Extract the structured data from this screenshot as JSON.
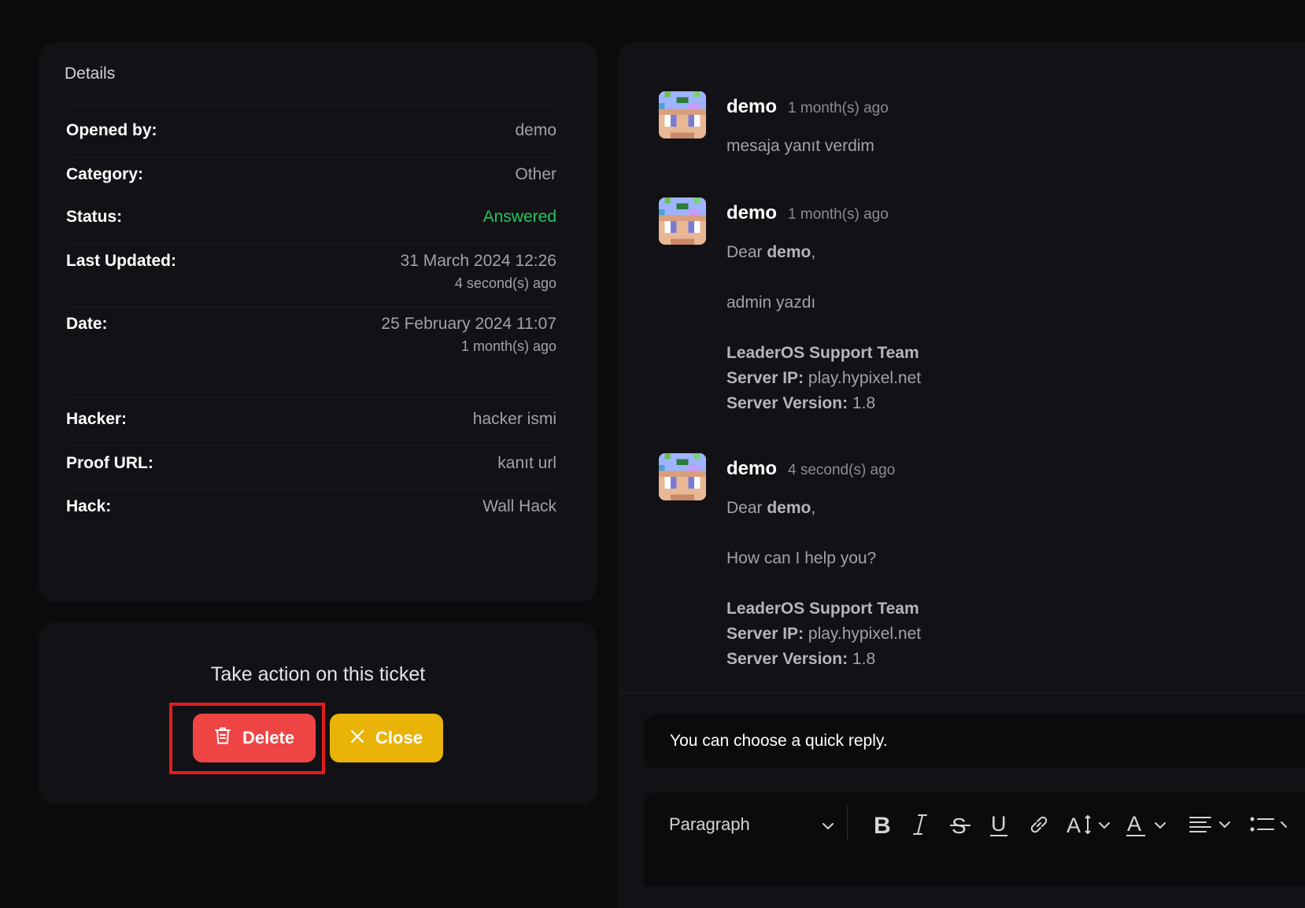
{
  "details": {
    "title": "Details",
    "rows": [
      {
        "label": "Opened by:",
        "value": "demo"
      },
      {
        "label": "Category:",
        "value": "Other"
      },
      {
        "label": "Status:",
        "value": "Answered"
      },
      {
        "label": "Last Updated:",
        "value": "31 March 2024 12:26",
        "sub": "4 second(s) ago"
      },
      {
        "label": "Date:",
        "value": "25 February 2024 11:07",
        "sub": "1 month(s) ago"
      },
      {
        "label": "Hacker:",
        "value": "hacker ismi"
      },
      {
        "label": "Proof URL:",
        "value": "kanıt url"
      },
      {
        "label": "Hack:",
        "value": "Wall Hack"
      }
    ],
    "status_color": "#22c55e"
  },
  "actions": {
    "title": "Take action on this ticket",
    "delete_label": "Delete",
    "close_label": "Close",
    "delete_color": "#ef4444",
    "close_color": "#eab308"
  },
  "messages": [
    {
      "author": "demo",
      "time": "1 month(s) ago",
      "text": "mesaja yanıt verdim"
    },
    {
      "author": "demo",
      "time": "1 month(s) ago",
      "greeting_prefix": "Dear ",
      "greeting_name": "demo",
      "greeting_suffix": ",",
      "body": "admin yazdı",
      "team": "LeaderOS Support Team",
      "ip_label": "Server IP:",
      "ip_value": " play.hypixel.net",
      "version_label": "Server Version:",
      "version_value": " 1.8"
    },
    {
      "author": "demo",
      "time": "4 second(s) ago",
      "greeting_prefix": "Dear ",
      "greeting_name": "demo",
      "greeting_suffix": ",",
      "body": "How can I help you?",
      "team": "LeaderOS Support Team",
      "ip_label": "Server IP:",
      "ip_value": " play.hypixel.net",
      "version_label": "Server Version:",
      "version_value": " 1.8"
    }
  ],
  "reply": {
    "quick_reply_placeholder": "You can choose a quick reply.",
    "paragraph_label": "Paragraph"
  },
  "toolbar_icons": [
    "bold-icon",
    "italic-icon",
    "strikethrough-icon",
    "underline-icon",
    "link-icon",
    "font-size-icon",
    "font-color-icon",
    "align-icon",
    "list-icon"
  ]
}
